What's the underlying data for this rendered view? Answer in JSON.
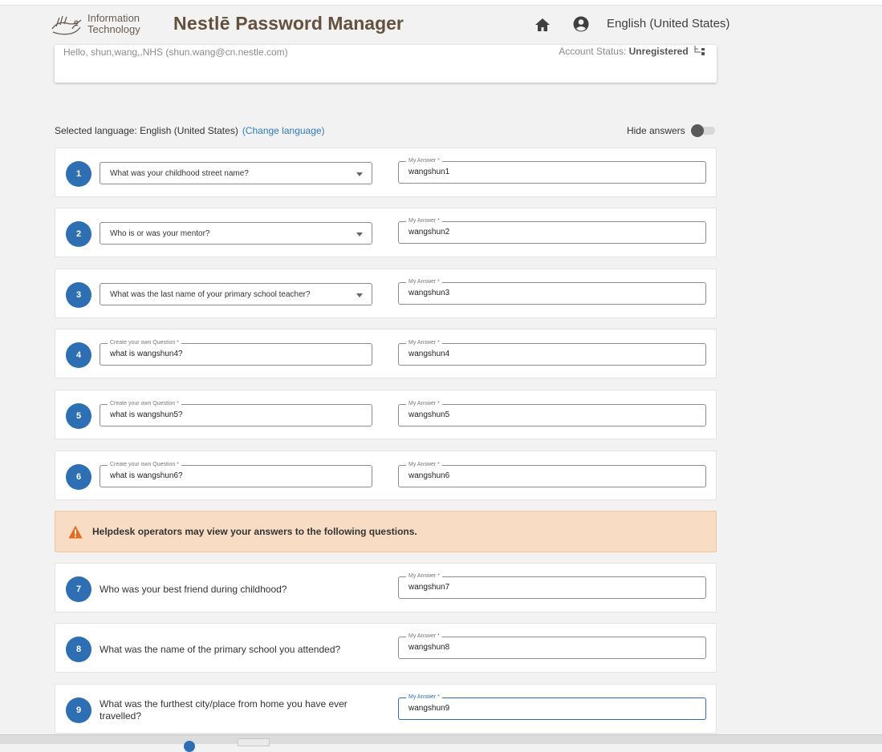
{
  "header": {
    "it_line1": "Information",
    "it_line2": "Technology",
    "brand_name": "Nestlē",
    "app_title": "Password Manager",
    "language": "English (United States)"
  },
  "greeting": {
    "text": "Hello, shun,wang,,NHS (shun.wang@cn.nestle.com)",
    "status_label": "Account Status:",
    "status_value": "Unregistered"
  },
  "language_bar": {
    "selected_label": "Selected language: English (United States)",
    "change_link": "(Change language)",
    "hide_answers_label": "Hide answers",
    "hide_answers_on": false
  },
  "field_labels": {
    "answer": "My Answer *",
    "own_question": "Create your own Question *"
  },
  "questions": [
    {
      "num": "1",
      "question": "What was your childhood street name?",
      "answer": "wangshun1"
    },
    {
      "num": "2",
      "question": "Who is or was your mentor?",
      "answer": "wangshun2"
    },
    {
      "num": "3",
      "question": "What was the last name of your primary school teacher?",
      "answer": "wangshun3"
    },
    {
      "num": "4",
      "question": "what is wangshun4?",
      "answer": "wangshun4"
    },
    {
      "num": "5",
      "question": "what is wangshun5?",
      "answer": "wangshun5"
    },
    {
      "num": "6",
      "question": "what is wangshun6?",
      "answer": "wangshun6"
    },
    {
      "num": "7",
      "question": "Who was your best friend during childhood?",
      "answer": "wangshun7"
    },
    {
      "num": "8",
      "question": "What was the name of the primary school you attended?",
      "answer": "wangshun8"
    },
    {
      "num": "9",
      "question": "What was the furthest city/place from home you have ever travelled?",
      "answer": "wangshun9"
    }
  ],
  "warning": {
    "text": "Helpdesk operators may view your answers to the following questions."
  },
  "colors": {
    "accent": "#2e6fb4",
    "brand": "#63513d",
    "warning_bg": "#f9dcc4",
    "warning_icon": "#e86a1c"
  }
}
